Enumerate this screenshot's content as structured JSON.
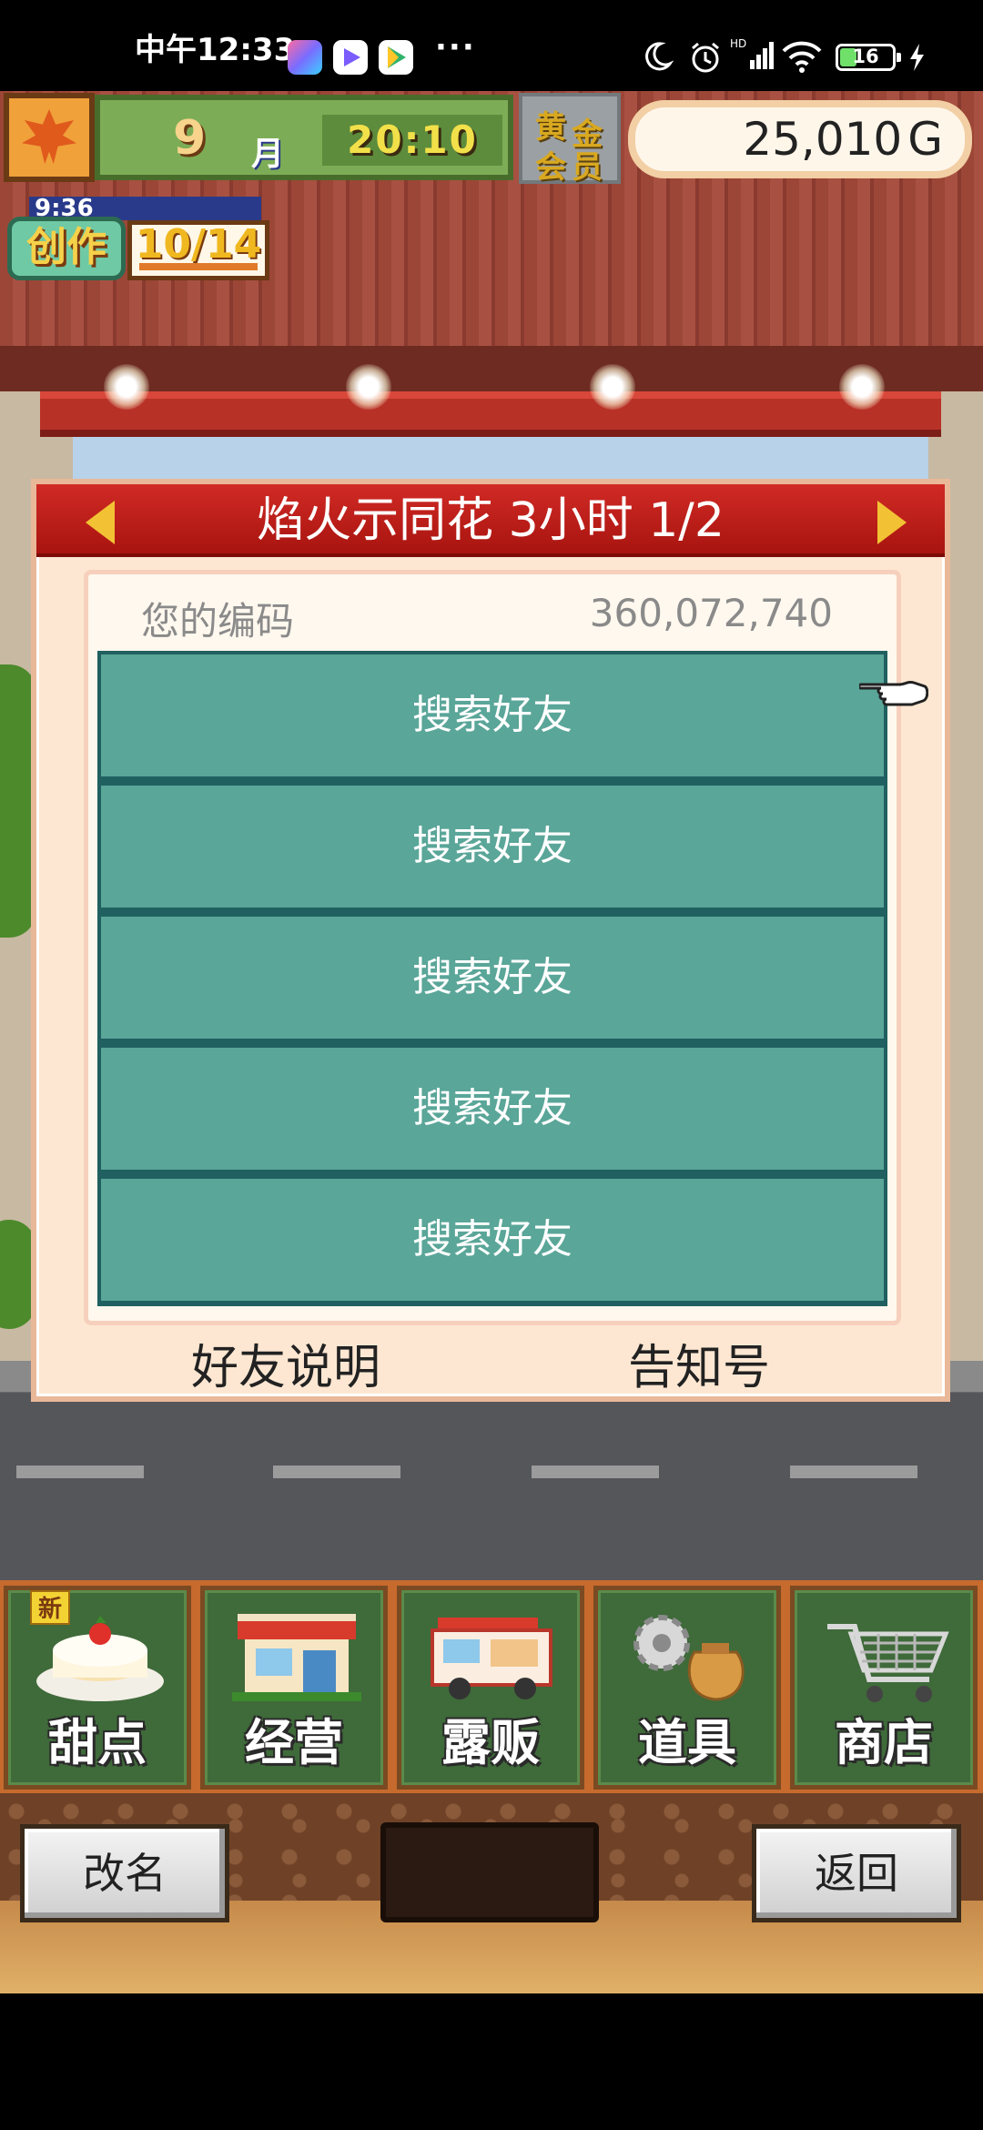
{
  "status_bar": {
    "time": "中午12:33",
    "dots": "···",
    "battery": "16",
    "app_icons": [
      "gallery-app-icon",
      "video-app-icon",
      "play-store-icon"
    ],
    "right_icons": [
      "moon-icon",
      "alarm-icon",
      "hd-signal-icon",
      "wifi-icon",
      "battery-icon",
      "charging-icon"
    ]
  },
  "hud": {
    "month_number": "9",
    "month_label": "月",
    "clock": "20:10",
    "gold_member": [
      "黄",
      "金",
      "会",
      "员"
    ],
    "money": "25,010",
    "currency": "G",
    "create_timer": "9:36",
    "create_label": "创作",
    "create_count": "10/14"
  },
  "dialog": {
    "title": "焰火示同花  3小时 1/2",
    "code_label": "您的编码",
    "code_value": "360,072,740",
    "friend_slots": [
      {
        "label": "搜索好友"
      },
      {
        "label": "搜索好友"
      },
      {
        "label": "搜索好友"
      },
      {
        "label": "搜索好友"
      },
      {
        "label": "搜索好友"
      }
    ],
    "footer_left": "好友说明",
    "footer_right": "告知号"
  },
  "menu": {
    "new_tag": "新",
    "items": [
      {
        "label": "甜点",
        "icon": "cake-icon"
      },
      {
        "label": "经营",
        "icon": "shop-icon"
      },
      {
        "label": "露贩",
        "icon": "food-truck-icon"
      },
      {
        "label": "道具",
        "icon": "gear-bag-icon"
      },
      {
        "label": "商店",
        "icon": "cart-icon"
      }
    ]
  },
  "bottom": {
    "rename": "改名",
    "back": "返回"
  },
  "colors": {
    "dialog_header": "#c41f1a",
    "friend_button": "#5aa699",
    "dialog_bg": "#fde7d2",
    "menu_tile": "#3f6a3a"
  }
}
